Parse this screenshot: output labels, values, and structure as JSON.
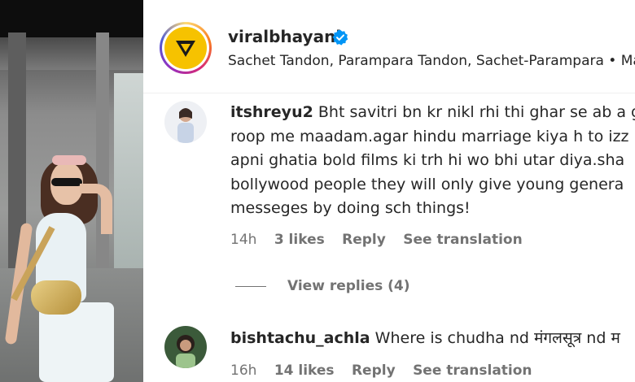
{
  "post": {
    "username": "viralbhayani",
    "verified_icon": "verified-badge-icon",
    "collaborators": "Sachet Tandon, Parampara Tandon, Sachet-Parampara • Ma"
  },
  "comments": [
    {
      "username": "itshreyu2",
      "lines": [
        "Bht savitri bn kr nikl rhi thi ghar se ab a g",
        "roop me maadam.agar hindu marriage kiya h to izz",
        "apni ghatia bold films ki trh hi wo bhi utar diya.sha",
        "bollywood people they will only give young genera",
        "messeges by doing sch things!"
      ],
      "time": "14h",
      "likes": "3 likes",
      "reply": "Reply",
      "translation": "See translation",
      "view_replies": "View replies (4)"
    },
    {
      "username": "bishtachu_achla",
      "lines": [
        "Where is chudha nd मंगलसूत्र nd म"
      ],
      "time": "16h",
      "likes": "14 likes",
      "reply": "Reply",
      "translation": "See translation"
    }
  ],
  "colors": {
    "text": "#262626",
    "secondary": "#737373",
    "verified": "#0095f6"
  }
}
